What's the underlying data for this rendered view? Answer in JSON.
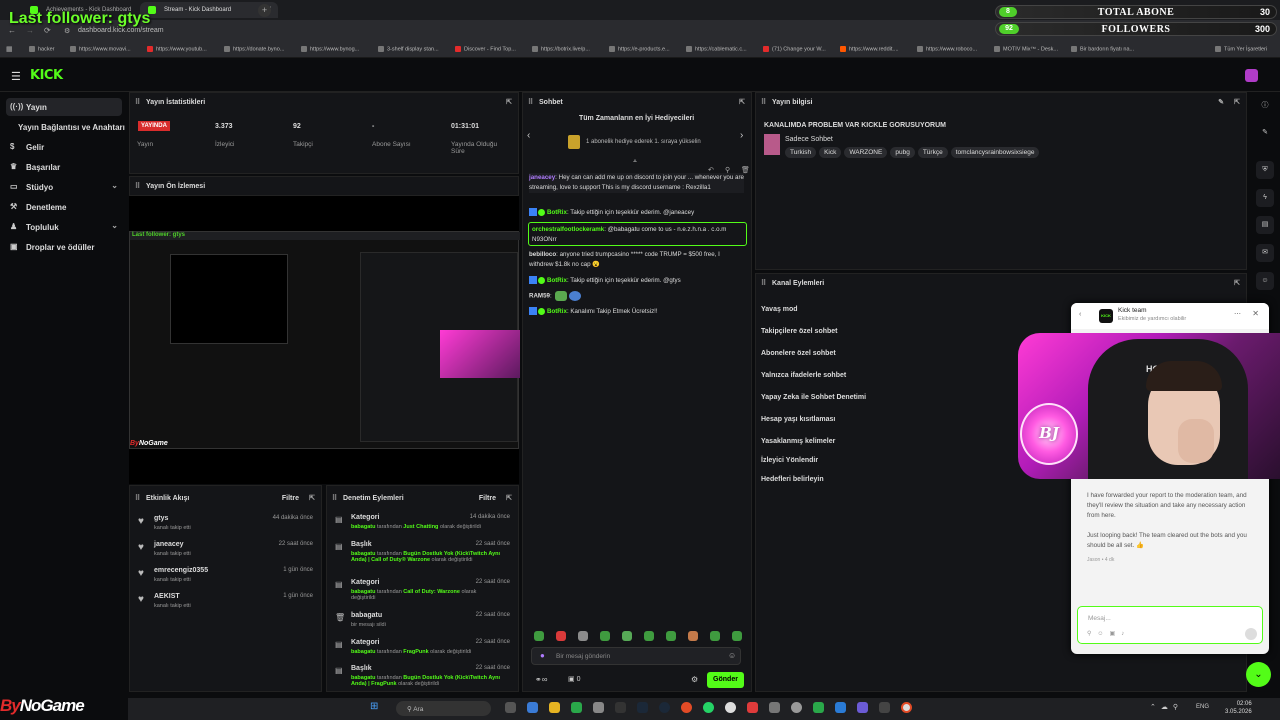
{
  "browser": {
    "tabs": [
      {
        "title": "Achievements - Kick Dashboard"
      },
      {
        "title": "Stream - Kick Dashboard"
      }
    ],
    "url": "dashboard.kick.com/stream",
    "bookmarks": [
      "hacker",
      "https://www.movavi...",
      "https://www.youtub...",
      "https://donate.byno...",
      "https://www.bynog...",
      "3-shelf display stan...",
      "Discover - Find Top...",
      "https://botrix.live/p...",
      "https://e-products.e...",
      "https://cablematic.c...",
      "(71) Change your W...",
      "https://www.reddit....",
      "https://www.roboco...",
      "MOTIV Mix™ - Desk...",
      "Bir bardorın fiyatı na...",
      "Tüm Yer İşaretleri"
    ]
  },
  "overlay": {
    "last_follower": "Last follower: gtys",
    "total_abone_label": "TOTAL ABONE",
    "total_abone_count": "8",
    "total_abone_goal": "30",
    "followers_label": "FOLLOWERS",
    "followers_count": "92",
    "followers_goal": "300",
    "brand_by": "By",
    "brand_rest": "NoGame"
  },
  "sidebar": {
    "items": [
      {
        "label": "Yayın",
        "icon": "broadcast-icon"
      },
      {
        "label": "Yayın Bağlantısı ve Anahtarı"
      },
      {
        "label": "Gelir",
        "icon": "money-icon"
      },
      {
        "label": "Başarılar",
        "icon": "trophy-icon"
      },
      {
        "label": "Stüdyo",
        "icon": "studio-icon"
      },
      {
        "label": "Denetleme",
        "icon": "hammer-icon"
      },
      {
        "label": "Topluluk",
        "icon": "users-icon"
      },
      {
        "label": "Droplar ve ödüller",
        "icon": "gift-icon"
      }
    ]
  },
  "stream_stats": {
    "title": "Yayın İstatistikleri",
    "live_badge": "YAYINDA",
    "status_label": "Yayın",
    "viewers": "3.373",
    "viewers_label": "İzleyici",
    "followers": "92",
    "followers_label": "Takipçi",
    "subs": "-",
    "subs_label": "Abone Sayısı",
    "uptime": "01:31:01",
    "uptime_label": "Yayında Olduğu Süre"
  },
  "preview": {
    "title": "Yayın Ön İzlemesi",
    "inner_label": "Last follower: gtys"
  },
  "activity": {
    "title": "Etkinlik Akışı",
    "filter": "Filtre",
    "events": [
      {
        "name": "gtys",
        "sub": "kanalı takip etti",
        "time": "44 dakika önce"
      },
      {
        "name": "janeacey",
        "sub": "kanalı takip etti",
        "time": "22 saat önce"
      },
      {
        "name": "emrecengiz0355",
        "sub": "kanalı takip etti",
        "time": "1 gün önce"
      },
      {
        "name": "AEKIST",
        "sub": "kanalı takip etti",
        "time": "1 gün önce"
      }
    ]
  },
  "mod_actions": {
    "title": "Denetim Eylemleri",
    "filter": "Filtre",
    "events": [
      {
        "name": "Kategori",
        "user": "babagatu",
        "mid": " tarafından ",
        "val": "Just Chatting",
        "end": " olarak değiştirildi",
        "time": "14 dakika önce"
      },
      {
        "name": "Başlık",
        "user": "babagatu",
        "mid": " tarafından ",
        "val": "Bugün Dostluk Yok (Kick\\Twitch Aynı Anda) | Call of Duty® Warzone",
        "end": " olarak değiştirildi",
        "time": "22 saat önce"
      },
      {
        "name": "Kategori",
        "user": "babagatu",
        "mid": " tarafından ",
        "val": "Call of Duty: Warzone",
        "end": " olarak değiştirildi",
        "time": "22 saat önce"
      },
      {
        "name": "babagatu",
        "user": "",
        "mid": "bir mesajı sildi",
        "val": "",
        "end": "",
        "time": "22 saat önce"
      },
      {
        "name": "Kategori",
        "user": "babagatu",
        "mid": " tarafından ",
        "val": "FragPunk",
        "end": " olarak değiştirildi",
        "time": "22 saat önce"
      },
      {
        "name": "Başlık",
        "user": "babagatu",
        "mid": " tarafından ",
        "val": "Bugün Dostluk Yok (Kick\\Twitch Aynı Anda) | FragPunk",
        "end": " olarak değiştirildi",
        "time": "22 saat önce"
      }
    ]
  },
  "chat": {
    "title": "Sohbet",
    "top_gifters_title": "Tüm Zamanların en İyi Hediyecileri",
    "top_gifter_text": "1 abonelik hediye ederek 1. sıraya yükselin",
    "messages": [
      {
        "user": "janeacey",
        "text": ": Hey can can add me up on discord to join your ... whenever you are streaming, love to support This is my discord username : Rexzilla1",
        "color": "#b07cff"
      },
      {
        "user": "BotRix",
        "text": ": Takip ettiğin için teşekkür ederim. @janeacey",
        "color": "#53fc18"
      },
      {
        "user": "orchestralfootlockeramk",
        "text": ": @babagatu come to us - n.e.z.h.n.a . c.o.m N93ONrr",
        "color": "#53fc18"
      },
      {
        "user": "bebilloco",
        "text": ": anyone tried trumpcasino ***** code TRUMP = $500 free, I withdrew $1.8k no cap 😮",
        "color": "#dddddd"
      },
      {
        "user": "BotRix",
        "text": ": Takip ettiğin için teşekkür ederim. @gtys",
        "color": "#53fc18"
      },
      {
        "user": "RAM59",
        "text": ":",
        "color": "#dddddd"
      },
      {
        "user": "BotRix",
        "text": ": Kanalımı Takip Etmek Ücretsiz!!",
        "color": "#53fc18"
      }
    ],
    "input_placeholder": "Bir mesaj gönderin",
    "counter": "0",
    "send_label": "Gönder"
  },
  "stream_info": {
    "title": "Yayın bilgisi",
    "stream_title": "KANALIMDA PROBLEM VAR KICKLE GORUSUYORUM",
    "category": "Sadece Sohbet",
    "tags": [
      "Turkish",
      "Kick",
      "WARZONE",
      "pubg",
      "Türkçe",
      "tomclancysrainbowsixsiege"
    ]
  },
  "channel_actions": {
    "title": "Kanal Eylemleri",
    "items": [
      "Yavaş mod",
      "Takipçilere özel sohbet",
      "Abonelere özel sohbet",
      "Yalnızca ifadelerle sohbet",
      "Yapay Zeka ile Sohbet Denetimi",
      "Hesap yaşı kısıtlaması",
      "Yasaklanmış kelimeler",
      "İzleyici Yönlendir",
      "Hedefleri belirleyin"
    ]
  },
  "support": {
    "team": "Kick team",
    "subtitle": "Ekibimiz de yardımcı olabilir",
    "logo_text": "KICK",
    "webcam_text": "HOV",
    "msg1": "I have forwarded your report to the moderation team, and they'll review the situation and take any necessary action from here.",
    "msg2": "Just looping back! The team cleared out the bots and you should be all set. 👍",
    "meta": "Jason • 4 dk",
    "input_placeholder": "Mesaj..."
  },
  "streamer_logo": "BJ",
  "taskbar": {
    "search_placeholder": "Ara",
    "lang": "ENG",
    "time": "02:06",
    "date": "3.05.2026"
  }
}
